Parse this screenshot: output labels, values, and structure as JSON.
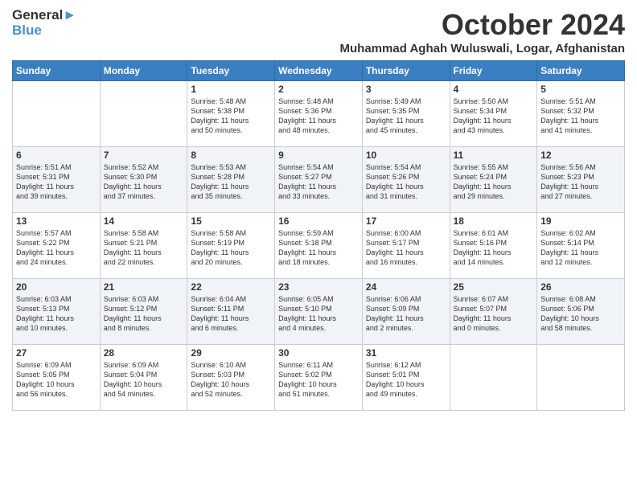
{
  "logo": {
    "line1": "General",
    "line2": "Blue"
  },
  "title": "October 2024",
  "location": "Muhammad Aghah Wuluswali, Logar, Afghanistan",
  "days_of_week": [
    "Sunday",
    "Monday",
    "Tuesday",
    "Wednesday",
    "Thursday",
    "Friday",
    "Saturday"
  ],
  "weeks": [
    [
      {
        "day": "",
        "content": ""
      },
      {
        "day": "",
        "content": ""
      },
      {
        "day": "1",
        "content": "Sunrise: 5:48 AM\nSunset: 5:38 PM\nDaylight: 11 hours\nand 50 minutes."
      },
      {
        "day": "2",
        "content": "Sunrise: 5:48 AM\nSunset: 5:36 PM\nDaylight: 11 hours\nand 48 minutes."
      },
      {
        "day": "3",
        "content": "Sunrise: 5:49 AM\nSunset: 5:35 PM\nDaylight: 11 hours\nand 45 minutes."
      },
      {
        "day": "4",
        "content": "Sunrise: 5:50 AM\nSunset: 5:34 PM\nDaylight: 11 hours\nand 43 minutes."
      },
      {
        "day": "5",
        "content": "Sunrise: 5:51 AM\nSunset: 5:32 PM\nDaylight: 11 hours\nand 41 minutes."
      }
    ],
    [
      {
        "day": "6",
        "content": "Sunrise: 5:51 AM\nSunset: 5:31 PM\nDaylight: 11 hours\nand 39 minutes."
      },
      {
        "day": "7",
        "content": "Sunrise: 5:52 AM\nSunset: 5:30 PM\nDaylight: 11 hours\nand 37 minutes."
      },
      {
        "day": "8",
        "content": "Sunrise: 5:53 AM\nSunset: 5:28 PM\nDaylight: 11 hours\nand 35 minutes."
      },
      {
        "day": "9",
        "content": "Sunrise: 5:54 AM\nSunset: 5:27 PM\nDaylight: 11 hours\nand 33 minutes."
      },
      {
        "day": "10",
        "content": "Sunrise: 5:54 AM\nSunset: 5:26 PM\nDaylight: 11 hours\nand 31 minutes."
      },
      {
        "day": "11",
        "content": "Sunrise: 5:55 AM\nSunset: 5:24 PM\nDaylight: 11 hours\nand 29 minutes."
      },
      {
        "day": "12",
        "content": "Sunrise: 5:56 AM\nSunset: 5:23 PM\nDaylight: 11 hours\nand 27 minutes."
      }
    ],
    [
      {
        "day": "13",
        "content": "Sunrise: 5:57 AM\nSunset: 5:22 PM\nDaylight: 11 hours\nand 24 minutes."
      },
      {
        "day": "14",
        "content": "Sunrise: 5:58 AM\nSunset: 5:21 PM\nDaylight: 11 hours\nand 22 minutes."
      },
      {
        "day": "15",
        "content": "Sunrise: 5:58 AM\nSunset: 5:19 PM\nDaylight: 11 hours\nand 20 minutes."
      },
      {
        "day": "16",
        "content": "Sunrise: 5:59 AM\nSunset: 5:18 PM\nDaylight: 11 hours\nand 18 minutes."
      },
      {
        "day": "17",
        "content": "Sunrise: 6:00 AM\nSunset: 5:17 PM\nDaylight: 11 hours\nand 16 minutes."
      },
      {
        "day": "18",
        "content": "Sunrise: 6:01 AM\nSunset: 5:16 PM\nDaylight: 11 hours\nand 14 minutes."
      },
      {
        "day": "19",
        "content": "Sunrise: 6:02 AM\nSunset: 5:14 PM\nDaylight: 11 hours\nand 12 minutes."
      }
    ],
    [
      {
        "day": "20",
        "content": "Sunrise: 6:03 AM\nSunset: 5:13 PM\nDaylight: 11 hours\nand 10 minutes."
      },
      {
        "day": "21",
        "content": "Sunrise: 6:03 AM\nSunset: 5:12 PM\nDaylight: 11 hours\nand 8 minutes."
      },
      {
        "day": "22",
        "content": "Sunrise: 6:04 AM\nSunset: 5:11 PM\nDaylight: 11 hours\nand 6 minutes."
      },
      {
        "day": "23",
        "content": "Sunrise: 6:05 AM\nSunset: 5:10 PM\nDaylight: 11 hours\nand 4 minutes."
      },
      {
        "day": "24",
        "content": "Sunrise: 6:06 AM\nSunset: 5:09 PM\nDaylight: 11 hours\nand 2 minutes."
      },
      {
        "day": "25",
        "content": "Sunrise: 6:07 AM\nSunset: 5:07 PM\nDaylight: 11 hours\nand 0 minutes."
      },
      {
        "day": "26",
        "content": "Sunrise: 6:08 AM\nSunset: 5:06 PM\nDaylight: 10 hours\nand 58 minutes."
      }
    ],
    [
      {
        "day": "27",
        "content": "Sunrise: 6:09 AM\nSunset: 5:05 PM\nDaylight: 10 hours\nand 56 minutes."
      },
      {
        "day": "28",
        "content": "Sunrise: 6:09 AM\nSunset: 5:04 PM\nDaylight: 10 hours\nand 54 minutes."
      },
      {
        "day": "29",
        "content": "Sunrise: 6:10 AM\nSunset: 5:03 PM\nDaylight: 10 hours\nand 52 minutes."
      },
      {
        "day": "30",
        "content": "Sunrise: 6:11 AM\nSunset: 5:02 PM\nDaylight: 10 hours\nand 51 minutes."
      },
      {
        "day": "31",
        "content": "Sunrise: 6:12 AM\nSunset: 5:01 PM\nDaylight: 10 hours\nand 49 minutes."
      },
      {
        "day": "",
        "content": ""
      },
      {
        "day": "",
        "content": ""
      }
    ]
  ]
}
